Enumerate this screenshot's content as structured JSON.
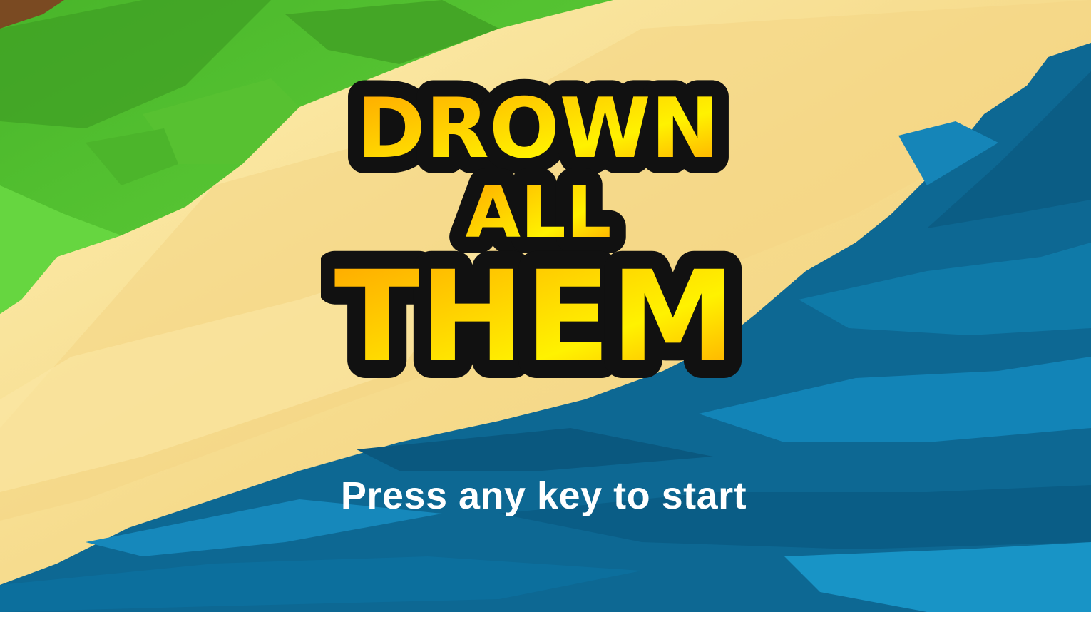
{
  "title": {
    "line1": "DROWN",
    "line2": "ALL",
    "line3": "THEM"
  },
  "prompt": "Press any key to start",
  "colors": {
    "grass": "#5ac832",
    "grass_dark": "#3e9a22",
    "sand": "#f7dc8d",
    "sand_light": "#fbe9a3",
    "water": "#0f6d98",
    "water_dark": "#0a5c82",
    "water_light": "#1e8ec1",
    "title_fill_top": "#ffa400",
    "title_fill_mid": "#fff200",
    "title_outline": "#111111",
    "prompt_text": "#ffffff"
  }
}
